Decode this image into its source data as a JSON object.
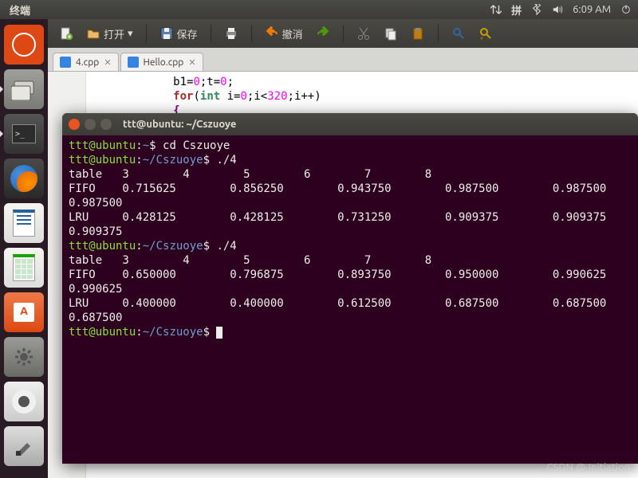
{
  "top_panel": {
    "app_title": "终端",
    "ime": "拼",
    "time": "6:09 AM"
  },
  "launcher": {
    "items": [
      {
        "name": "ubuntu-dash"
      },
      {
        "name": "files"
      },
      {
        "name": "terminal"
      },
      {
        "name": "firefox"
      },
      {
        "name": "libreoffice-writer"
      },
      {
        "name": "libreoffice-calc"
      },
      {
        "name": "software-center"
      },
      {
        "name": "system-settings"
      },
      {
        "name": "amazon"
      },
      {
        "name": "brush-app"
      }
    ]
  },
  "editor": {
    "toolbar": {
      "open": "打开",
      "save": "保存",
      "undo": "撤消"
    },
    "tabs": [
      {
        "label": "4.cpp"
      },
      {
        "label": "Hello.cpp"
      }
    ],
    "code_lines": [
      "b1=0;t=0;",
      "for(int i=0;i<320;i++)",
      "{"
    ]
  },
  "terminal": {
    "title": "ttt@ubuntu: ~/Cszuoye",
    "user_host": "ttt@ubuntu",
    "home_path": "~",
    "work_path": "~/Cszuoye",
    "cmd_cd": "cd Cszuoye",
    "cmd_run": "./4",
    "runs": [
      {
        "header": "table   3        4        5        6        7        8",
        "rows": [
          "FIFO    0.715625        0.856250        0.943750        0.987500        0.987500",
          "0.987500",
          "LRU     0.428125        0.428125        0.731250        0.909375        0.909375",
          "0.909375"
        ]
      },
      {
        "header": "table   3        4        5        6        7        8",
        "rows": [
          "FIFO    0.650000        0.796875        0.893750        0.950000        0.990625",
          "0.990625",
          "LRU     0.400000        0.400000        0.612500        0.687500        0.687500",
          "0.687500"
        ]
      }
    ]
  },
  "watermark": "CSDN @-Initiation"
}
